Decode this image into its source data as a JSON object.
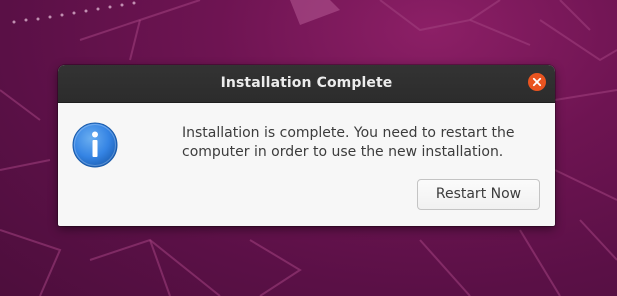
{
  "dialog": {
    "title": "Installation Complete",
    "message_line1": "Installation is complete. You need to restart the",
    "message_line2": "computer in order to use the new installation.",
    "restart_label": "Restart Now",
    "icon": "info-icon",
    "close_icon": "close-icon"
  },
  "colors": {
    "wallpaper": "#6e1452",
    "titlebar": "#2c2c2c",
    "close_button": "#e95420",
    "info_icon": "#3584e4",
    "dialog_body": "#f7f7f7"
  }
}
